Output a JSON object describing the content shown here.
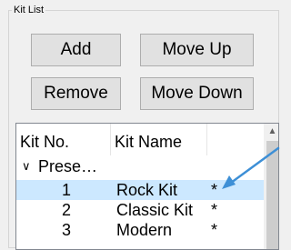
{
  "group": {
    "title": "Kit List"
  },
  "buttons": {
    "add": "Add",
    "move_up": "Move Up",
    "remove": "Remove",
    "move_down": "Move Down"
  },
  "list": {
    "columns": [
      "Kit No.",
      "Kit Name",
      ""
    ],
    "group_label": "Prese…",
    "rows": [
      {
        "no": "1",
        "name": "Rock Kit",
        "mark": "*",
        "selected": true
      },
      {
        "no": "2",
        "name": "Classic Kit",
        "mark": "*",
        "selected": false
      },
      {
        "no": "3",
        "name": "Modern",
        "mark": "*",
        "selected": false
      }
    ]
  },
  "colors": {
    "selection": "#cce8ff",
    "annotation_arrow": "#3d8fd6"
  },
  "icons": {
    "expand": "chevron-down-icon",
    "scroll_up": "scroll-up-arrow-icon"
  }
}
